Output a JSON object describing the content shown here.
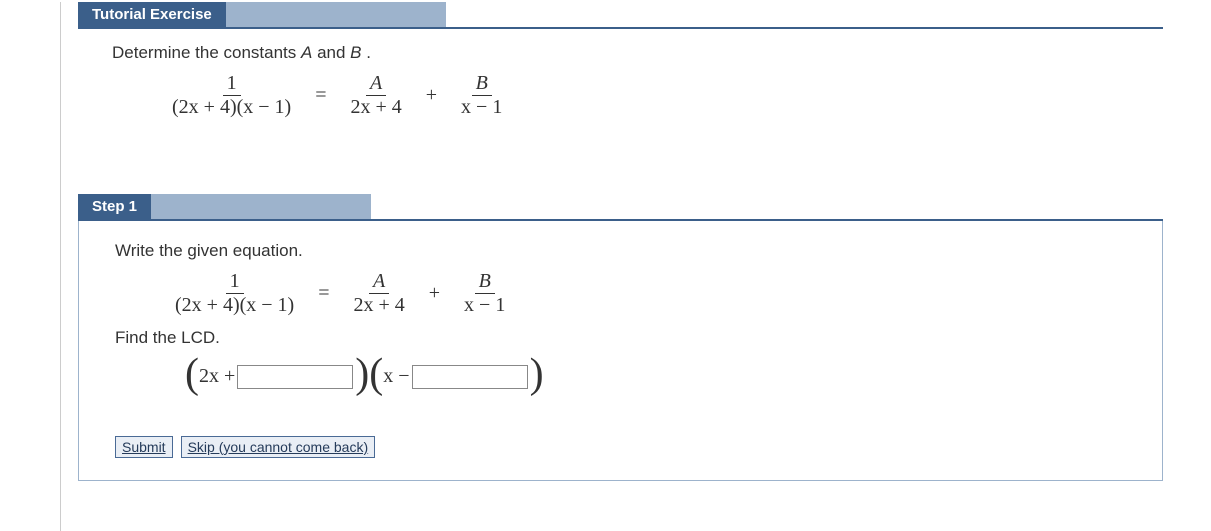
{
  "tutorial": {
    "tab_label": "Tutorial Exercise",
    "prompt": {
      "pre": "Determine the constants ",
      "A": "A",
      "and": " and ",
      "B": "B",
      "period": "."
    }
  },
  "eq": {
    "left": {
      "num": "1",
      "den": "(2x + 4)(x − 1)"
    },
    "equals": "=",
    "A": {
      "num": "A",
      "den": "2x + 4"
    },
    "plus": "+",
    "B": {
      "num": "B",
      "den": "x − 1"
    }
  },
  "step": {
    "tab_label": "Step 1",
    "line1": "Write the given equation.",
    "line2": "Find the LCD."
  },
  "lcd": {
    "paren_open": "(",
    "paren_close": ")",
    "term1": "2x + ",
    "term2": "x − ",
    "input1": "",
    "input2": ""
  },
  "buttons": {
    "submit": "Submit",
    "skip": "Skip (you cannot come back)"
  }
}
